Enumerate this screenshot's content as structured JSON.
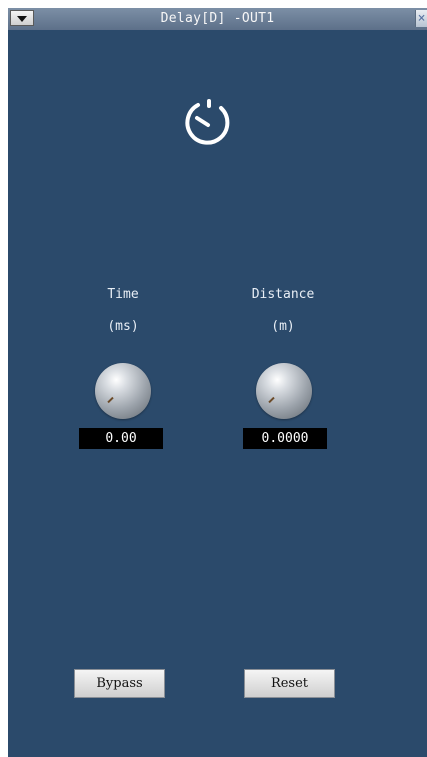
{
  "window": {
    "title": "Delay[D] -OUT1",
    "background_color": "#2b4a6b"
  },
  "icons": {
    "menu": "chevron-down-icon",
    "close": "close-icon",
    "timer": "timer-icon"
  },
  "titlebar": {
    "close_glyph": "×"
  },
  "params": {
    "time": {
      "label": "Time",
      "unit": "(ms)",
      "value": "0.00"
    },
    "distance": {
      "label": "Distance",
      "unit": "(m)",
      "value": "0.0000"
    }
  },
  "buttons": {
    "bypass": "Bypass",
    "reset": "Reset"
  }
}
